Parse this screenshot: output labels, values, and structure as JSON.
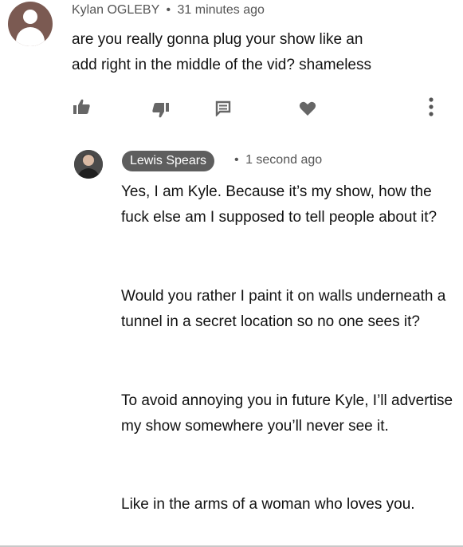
{
  "comment": {
    "author": "Kylan OGLEBY",
    "separator": "•",
    "timestamp": "31 minutes ago",
    "text": "are you really gonna plug your show like an\nadd right in the middle of the vid? shameless",
    "actions": {
      "like_icon": "thumbs-up-icon",
      "dislike_icon": "thumbs-down-icon",
      "reply_icon": "reply-icon",
      "heart_icon": "heart-icon",
      "more_icon": "more-vertical-icon"
    }
  },
  "reply": {
    "author": "Lewis Spears",
    "separator": "•",
    "timestamp": "1 second ago",
    "paragraphs": [
      "Yes, I am Kyle. Because it’s my show, how the fuck else am I supposed to tell people about it?",
      "Would you rather I paint it on walls underneath a tunnel in a secret location so no one sees it?",
      "To avoid annoying you in future Kyle,  I’ll advertise my show somewhere you’ll never see it.",
      "Like in the arms of a woman who loves you."
    ]
  },
  "colors": {
    "avatar_default": "#7b5a52",
    "author_chip": "#5e5e5e",
    "icon": "#666666",
    "text": "#111111",
    "meta": "#555555"
  }
}
